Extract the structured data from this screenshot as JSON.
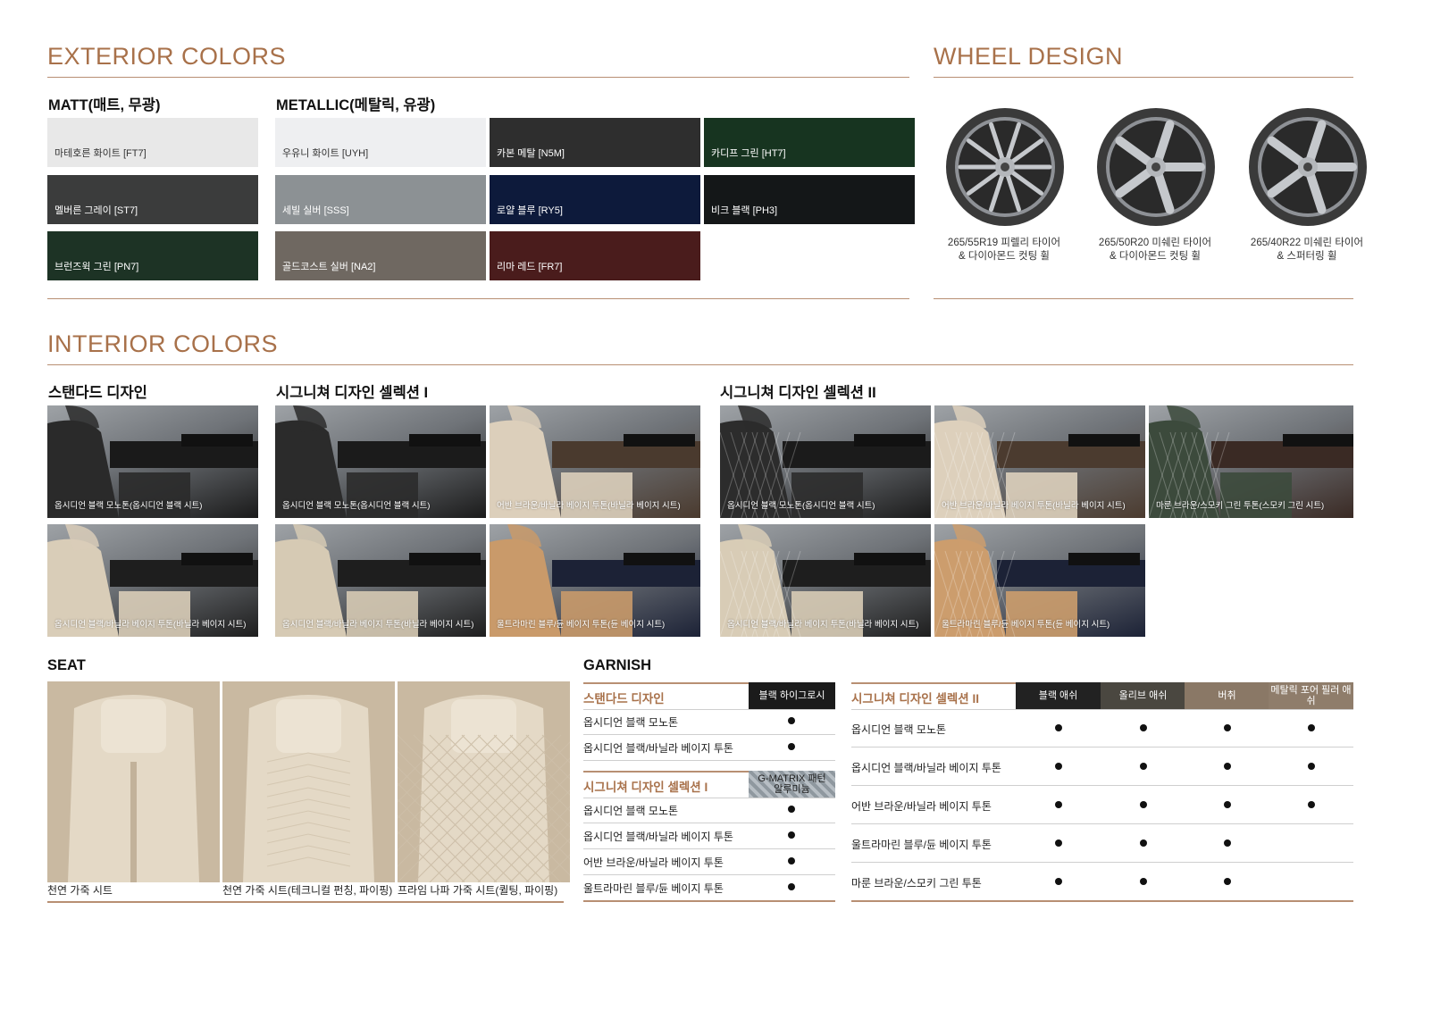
{
  "exterior": {
    "title": "EXTERIOR COLORS",
    "matt_label": "MATT(매트, 무광)",
    "metallic_label": "METALLIC(메탈릭, 유광)",
    "matt": [
      {
        "name": "마테호른 화이트 [FT7]",
        "color": "#e8e8e8"
      },
      {
        "name": "멜버른 그레이 [ST7]",
        "color": "#3b3c3c"
      },
      {
        "name": "브런즈윅 그린 [PN7]",
        "color": "#1d3325"
      }
    ],
    "metallic": [
      {
        "name": "우유니 화이트 [UYH]",
        "color": "#eeeff1"
      },
      {
        "name": "카본 메탈 [N5M]",
        "color": "#2e2e2e"
      },
      {
        "name": "카디프 그린 [HT7]",
        "color": "#173420"
      },
      {
        "name": "세빌 실버 [SSS]",
        "color": "#8c9194"
      },
      {
        "name": "로얄 블루 [RY5]",
        "color": "#0d1a3b"
      },
      {
        "name": "비크 블랙 [PH3]",
        "color": "#141718"
      },
      {
        "name": "골드코스트 실버 [NA2]",
        "color": "#6f6861"
      },
      {
        "name": "리마 레드 [FR7]",
        "color": "#4a1c1c"
      }
    ]
  },
  "wheels": {
    "title": "WHEEL DESIGN",
    "items": [
      {
        "line1": "265/55R19 피렐리 타이어",
        "line2": "& 다이아몬드 컷팅 휠",
        "icon": "wheel-19-icon"
      },
      {
        "line1": "265/50R20 미쉐린 타이어",
        "line2": "& 다이아몬드 컷팅 휠",
        "icon": "wheel-20-icon"
      },
      {
        "line1": "265/40R22 미쉐린 타이어",
        "line2": "& 스퍼터링 휠",
        "icon": "wheel-22-icon"
      }
    ]
  },
  "interior": {
    "title": "INTERIOR COLORS",
    "standard_label": "스탠다드 디자인",
    "sig1_label": "시그니쳐 디자인 셀렉션 I",
    "sig2_label": "시그니쳐 디자인 셀렉션 II",
    "standard": [
      {
        "caption": "옵시디언 블랙 모노톤(옵시디언 블랙 시트)",
        "seat": "#2a2a2a",
        "dash": "#1a1a1a"
      },
      {
        "caption": "옵시디언 블랙/바닐라 베이지 투톤(바닐라 베이지 시트)",
        "seat": "#d9cdb8",
        "dash": "#1e1e1e"
      }
    ],
    "sig1": [
      {
        "caption": "옵시디언 블랙 모노톤(옵시디언 블랙 시트)",
        "seat": "#2b2b2b",
        "dash": "#1b1b1b"
      },
      {
        "caption": "어반 브라운/바닐라 베이지 투톤(바닐라 베이지 시트)",
        "seat": "#dccfbb",
        "dash": "#4a3a2e"
      },
      {
        "caption": "옵시디언 블랙/바닐라 베이지 투톤(바닐라 베이지 시트)",
        "seat": "#d6cab4",
        "dash": "#1e1e1e"
      },
      {
        "caption": "울트라마린 블루/듄 베이지 투톤(듄 베이지 시트)",
        "seat": "#c99a6a",
        "dash": "#1c2236"
      }
    ],
    "sig2": [
      {
        "caption": "옵시디언 블랙 모노톤(옵시디언 블랙 시트)",
        "seat": "#2c2c2c",
        "dash": "#1b1b1b"
      },
      {
        "caption": "어반 브라운/바닐라 베이지 투톤(바닐라 베이지 시트)",
        "seat": "#ddd0bc",
        "dash": "#4b3b2f"
      },
      {
        "caption": "마룬 브라운/스모키 그린 투톤(스모키 그린 시트)",
        "seat": "#3c4a3c",
        "dash": "#3a2a24"
      },
      {
        "caption": "옵시디언 블랙/바닐라 베이지 투톤(바닐라 베이지 시트)",
        "seat": "#d8ccb6",
        "dash": "#1e1e1e"
      },
      {
        "caption": "울트라마린 블루/듄 베이지 투톤(듄 베이지 시트)",
        "seat": "#cc9d6d",
        "dash": "#1c2236"
      }
    ]
  },
  "seat": {
    "title": "SEAT",
    "items": [
      {
        "caption": "천연 가죽 시트"
      },
      {
        "caption": "천연 가죽 시트(테크니컬 펀칭, 파이핑)"
      },
      {
        "caption": "프라임 나파 가죽 시트(퀼팅, 파이핑)"
      }
    ]
  },
  "garnish": {
    "title": "GARNISH",
    "standard": {
      "label": "스탠다드 디자인",
      "swatch": "블랙 하이그로시",
      "swatch_color": "#1b1b1b",
      "rows": [
        "옵시디언 블랙 모노톤",
        "옵시디언 블랙/바닐라 베이지 투톤"
      ]
    },
    "sig1": {
      "label": "시그니쳐 디자인 셀렉션 I",
      "swatch": "G-MATRIX 패턴 알루미늄",
      "swatch_color": "#9aa3aa",
      "rows": [
        "옵시디언 블랙 모노톤",
        "옵시디언 블랙/바닐라 베이지 투톤",
        "어반 브라운/바닐라 베이지 투톤",
        "울트라마린 블루/듄 베이지 투톤"
      ]
    },
    "sig2": {
      "label": "시그니쳐 디자인 셀렉션 II",
      "columns": [
        {
          "name": "블랙 애쉬",
          "color": "#222222"
        },
        {
          "name": "올리브 애쉬",
          "color": "#4a4740"
        },
        {
          "name": "버취",
          "color": "#8a7866"
        },
        {
          "name": "메탈릭 포어 필러 애쉬",
          "color": "#8f7d6b"
        }
      ],
      "rows": [
        {
          "name": "옵시디언 블랙 모노톤",
          "marks": [
            1,
            1,
            1,
            1
          ]
        },
        {
          "name": "옵시디언 블랙/바닐라 베이지 투톤",
          "marks": [
            1,
            1,
            1,
            1
          ]
        },
        {
          "name": "어반 브라운/바닐라 베이지 투톤",
          "marks": [
            1,
            1,
            1,
            1
          ]
        },
        {
          "name": "울트라마린 블루/듄 베이지 투톤",
          "marks": [
            1,
            1,
            1,
            0
          ]
        },
        {
          "name": "마룬 브라운/스모키 그린 투톤",
          "marks": [
            1,
            1,
            1,
            0
          ]
        }
      ]
    }
  }
}
